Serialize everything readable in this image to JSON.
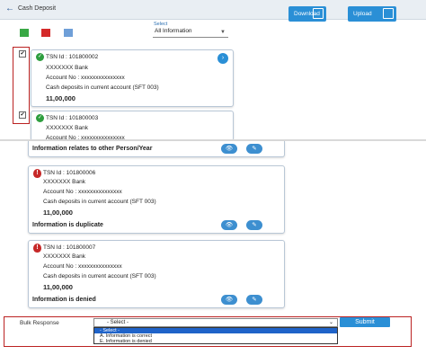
{
  "header": {
    "title": "Cash Deposit",
    "back_icon": "back-arrow-icon",
    "download_label": "Download",
    "upload_label": "Upload"
  },
  "colors": {
    "accent": "#2a8fd6",
    "green": "#2e9e3e",
    "red": "#c62828",
    "blue_swatch": "#6f9fd8",
    "green_swatch": "#39a845",
    "red_swatch": "#d42a2a"
  },
  "filter": {
    "caption": "Select",
    "value": "All Information"
  },
  "cards": [
    {
      "tsn": "TSN Id : 101800002",
      "bank": "XXXXXXX Bank",
      "account": "Account No : xxxxxxxxxxxxxxx",
      "desc": "Cash deposits in current account (SFT 003)",
      "amount": "11,00,000"
    },
    {
      "tsn": "TSN Id : 101800003",
      "bank": "XXXXXXX Bank",
      "account": "Account No : xxxxxxxxxxxxxxx"
    },
    {
      "status": "Information relates to other Person/Year"
    },
    {
      "tsn": "TSN Id : 101800006",
      "bank": "XXXXXXX Bank",
      "account": "Account No : xxxxxxxxxxxxxxx",
      "desc": "Cash deposits in current account (SFT 003)",
      "amount": "11,00,000",
      "status": "Information is duplicate"
    },
    {
      "tsn": "TSN Id : 101800007",
      "bank": "XXXXXXX Bank",
      "account": "Account No : xxxxxxxxxxxxxxx",
      "desc": "Cash deposits in current account (SFT 003)",
      "amount": "11,00,000",
      "status": "Information is denied"
    }
  ],
  "bulk": {
    "label": "Bulk Response",
    "selected": "- Select -",
    "submit_label": "Submit",
    "options": [
      "- Select -",
      "A. Information is correct",
      "E. Information is denied"
    ]
  }
}
